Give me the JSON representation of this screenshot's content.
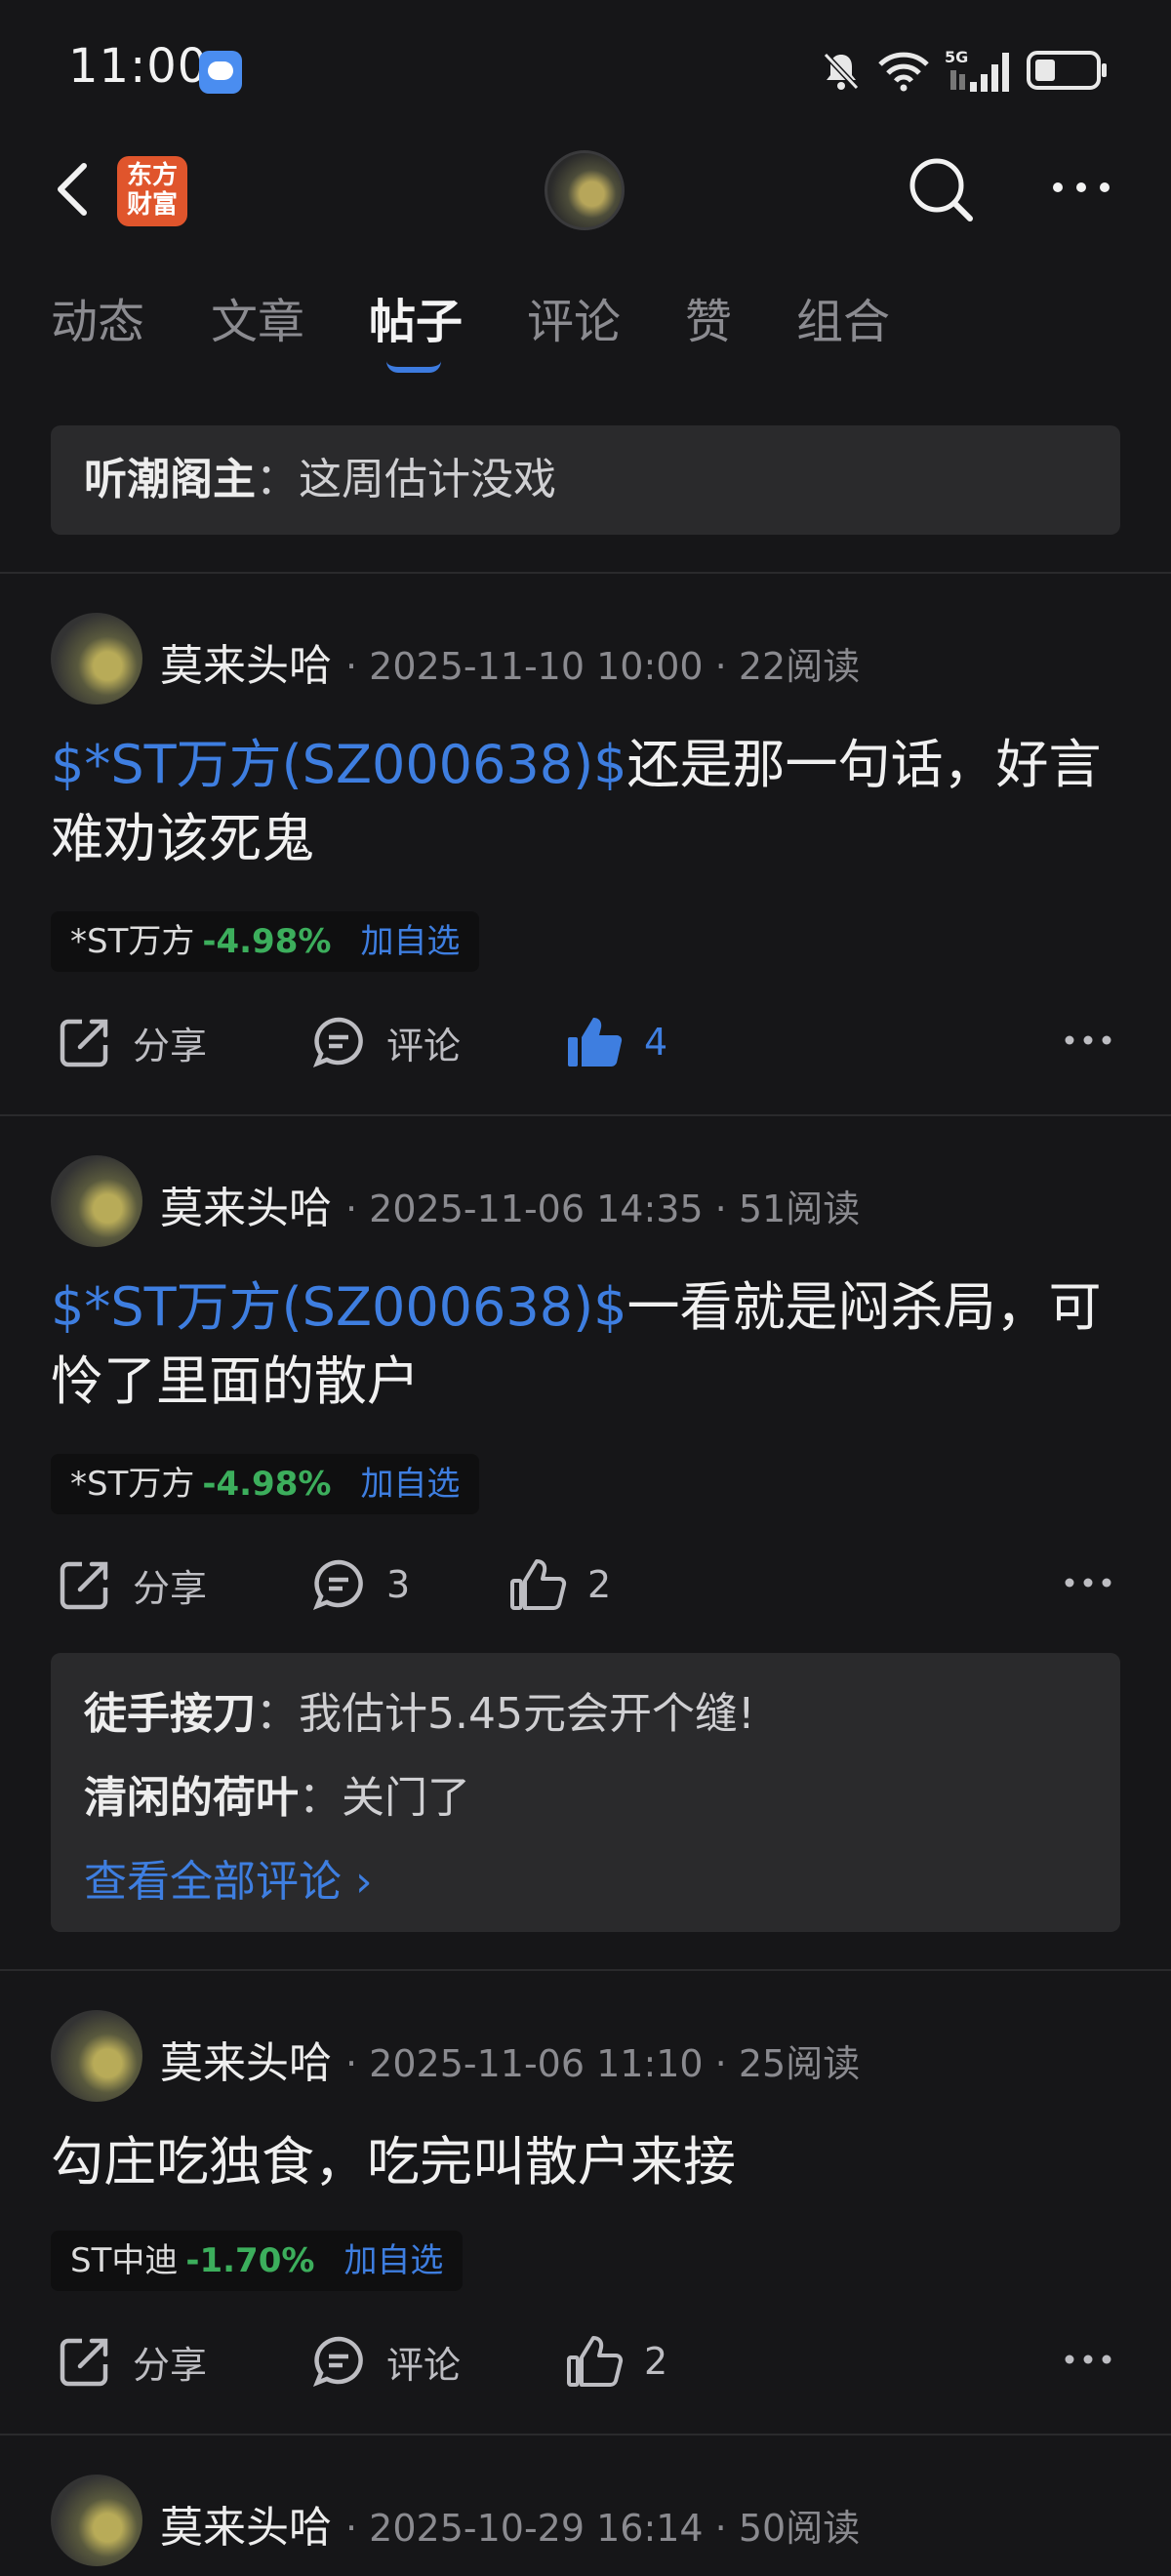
{
  "status_bar": {
    "time": "11:00",
    "network": "5G"
  },
  "header": {
    "logo_text": "东方财富"
  },
  "tabs": [
    {
      "label": "动态"
    },
    {
      "label": "文章"
    },
    {
      "label": "帖子"
    },
    {
      "label": "评论"
    },
    {
      "label": "赞"
    },
    {
      "label": "组合"
    }
  ],
  "pinned": {
    "author": "听潮阁主",
    "text": "这周估计没戏"
  },
  "posts": [
    {
      "author": "莫来头哈",
      "meta": "2025-11-10 10:00 · 22阅读",
      "tag": "$*ST万方(SZ000638)$",
      "text": "还是那一句话，好言难劝该死鬼",
      "chip": {
        "name": "*ST万方",
        "pct": "-4.98%",
        "add": "加自选"
      },
      "share": "分享",
      "comment": "评论",
      "like": "4"
    },
    {
      "author": "莫来头哈",
      "meta": "2025-11-06 14:35 · 51阅读",
      "tag": "$*ST万方(SZ000638)$",
      "text": "一看就是闷杀局，可怜了里面的散户",
      "chip": {
        "name": "*ST万方",
        "pct": "-4.98%",
        "add": "加自选"
      },
      "share": "分享",
      "comment": "3",
      "like": "2",
      "comments": [
        {
          "user": "徒手接刀",
          "text": "我估计5.45元会开个缝!"
        },
        {
          "user": "清闲的荷叶",
          "text": "关门了"
        }
      ],
      "view_all": "查看全部评论 ›"
    },
    {
      "author": "莫来头哈",
      "meta": "2025-11-06 11:10 · 25阅读",
      "text": "勾庄吃独食，吃完叫散户来接",
      "chip": {
        "name": "ST中迪",
        "pct": "-1.70%",
        "add": "加自选"
      },
      "share": "分享",
      "comment": "评论",
      "like": "2"
    },
    {
      "author": "莫来头哈",
      "meta": "2025-10-29 16:14 · 50阅读"
    }
  ]
}
